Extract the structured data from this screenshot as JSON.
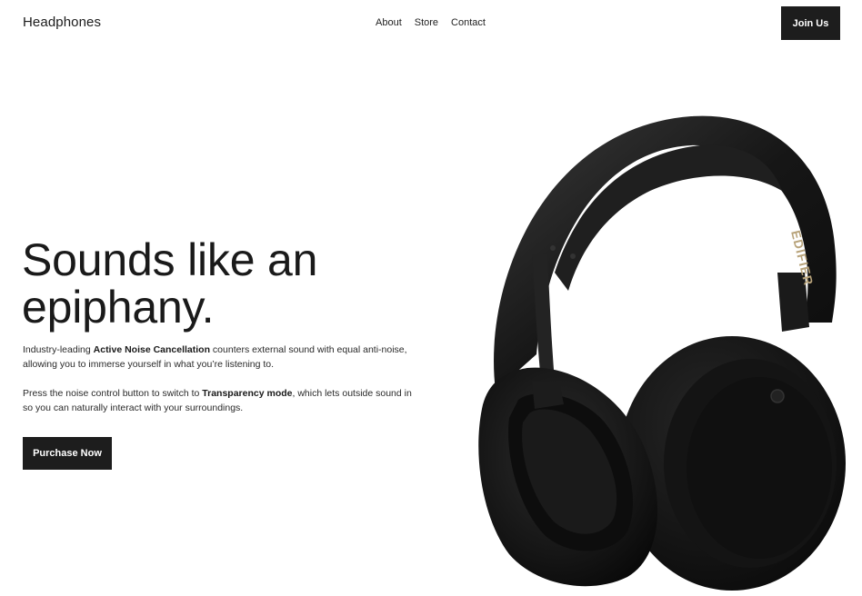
{
  "header": {
    "brand": "Headphones",
    "nav": [
      "About",
      "Store",
      "Contact"
    ],
    "join_label": "Join Us"
  },
  "hero": {
    "headline_line1": "Sounds like an",
    "headline_line2": "epiphany.",
    "p1_pre": "Industry-leading ",
    "p1_bold": "Active Noise Cancellation",
    "p1_post": " counters external sound with equal anti-noise, allowing you to immerse yourself in what you’re listening to.",
    "p2_pre": "Press the noise control button to switch to ",
    "p2_bold": "Transparency mode",
    "p2_post": ", which lets outside sound in so you can naturally interact with your surroundings.",
    "cta_label": "Purchase Now"
  },
  "product": {
    "brand_mark": "EDIFIER",
    "color": "#1a1a1a"
  }
}
